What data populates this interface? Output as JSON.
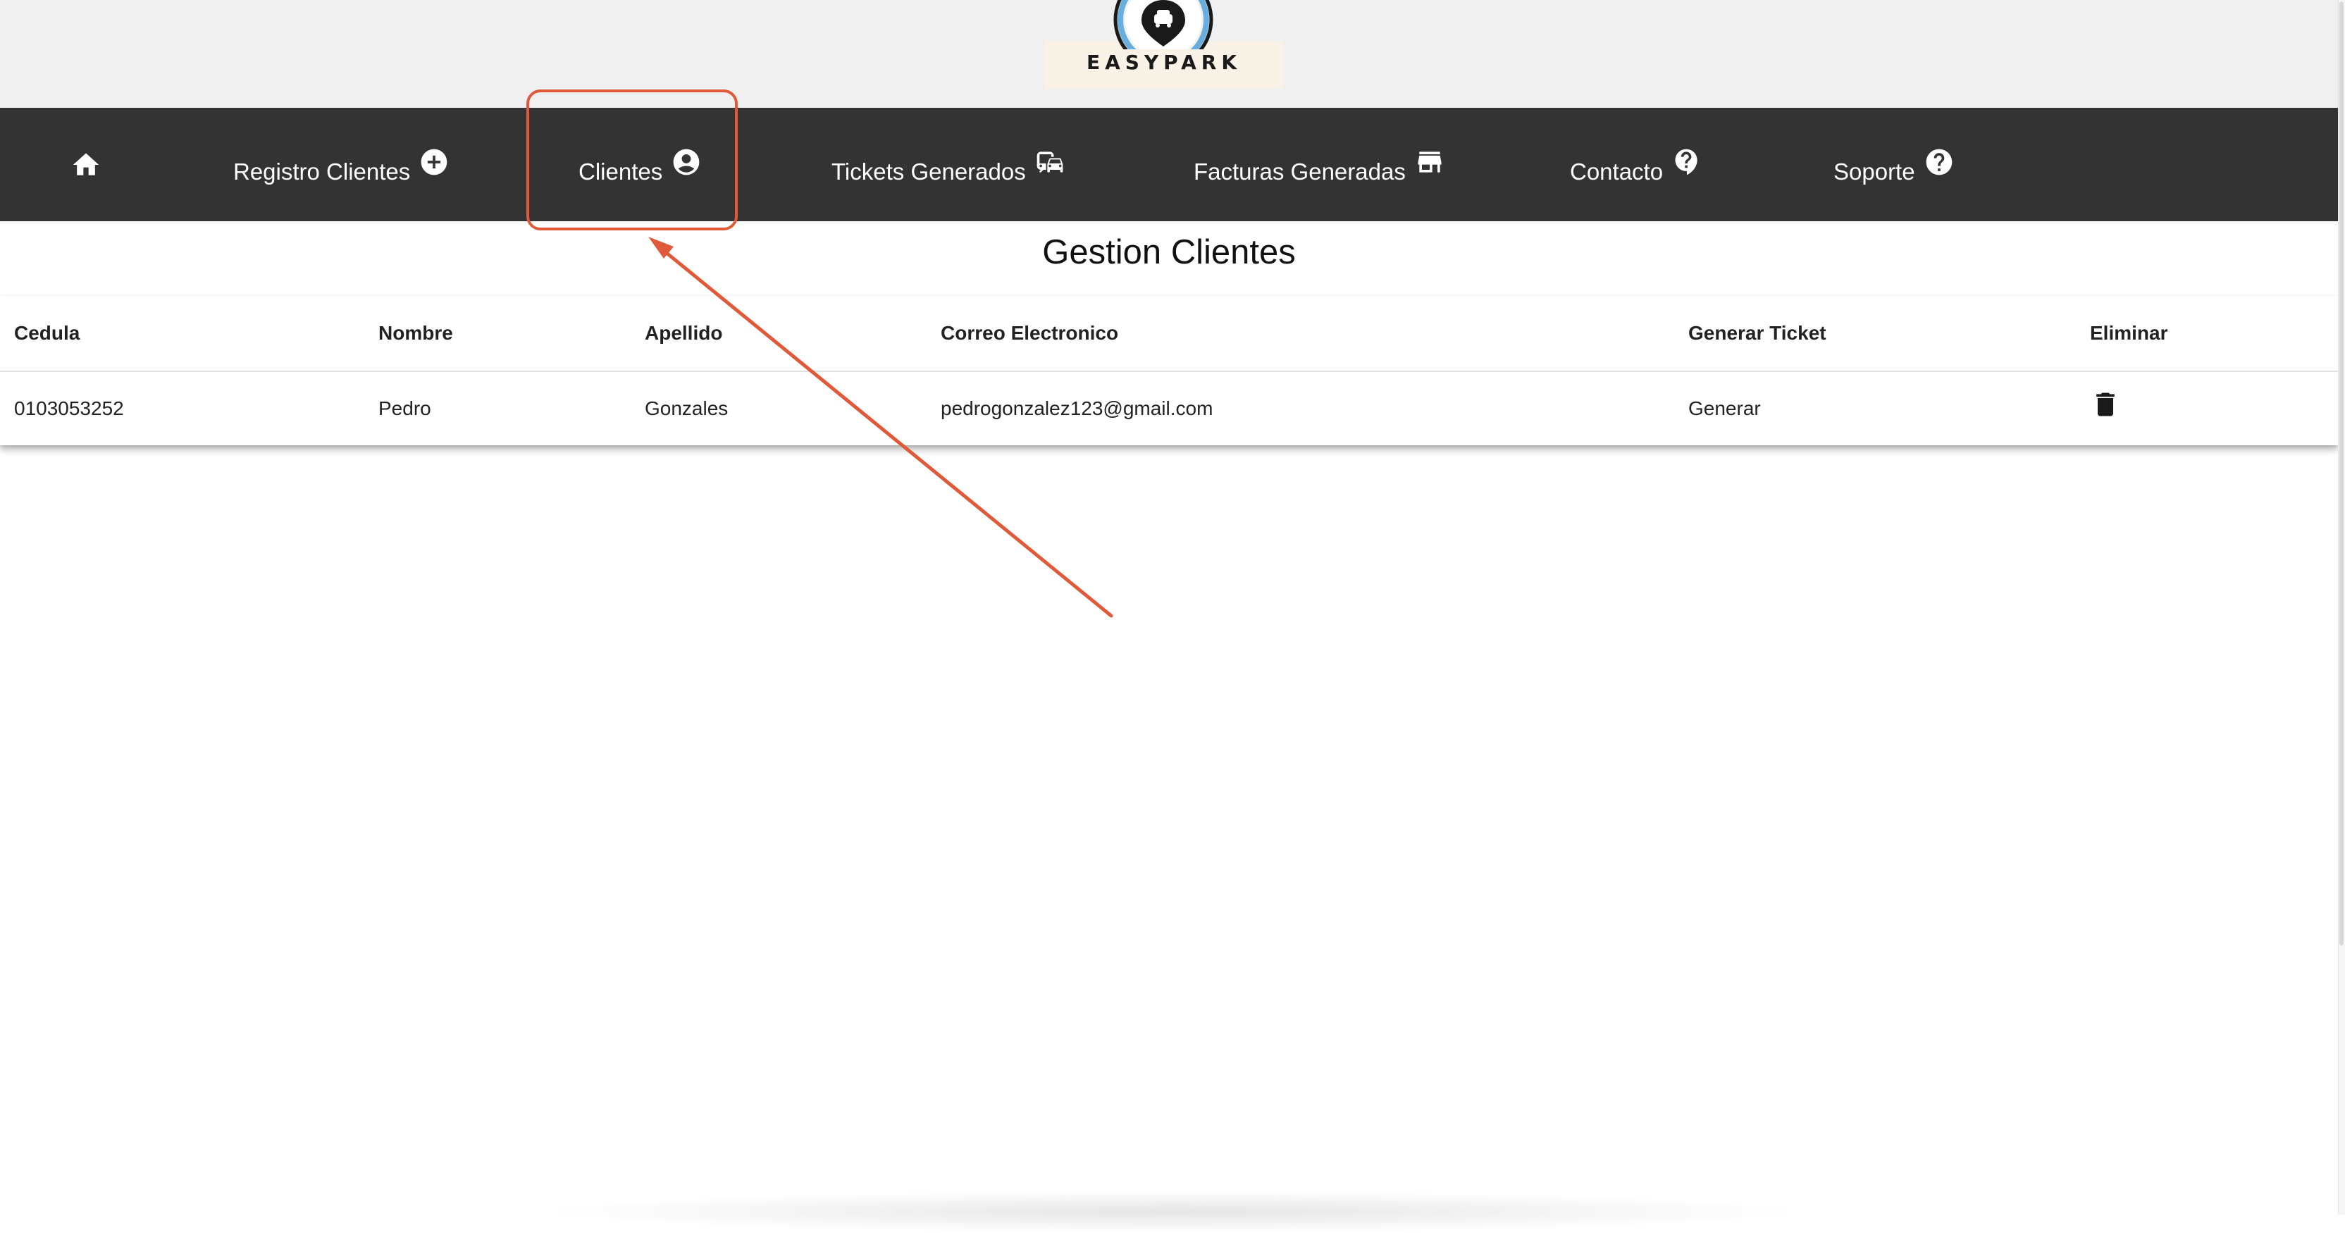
{
  "brand": {
    "name": "EASYPARK",
    "logo_icon": "car-pin-icon"
  },
  "navbar": {
    "items": [
      {
        "label": "",
        "icon": "home-icon"
      },
      {
        "label": "Registro Clientes",
        "icon": "add-circle-icon"
      },
      {
        "label": "Clientes",
        "icon": "account-circle-icon"
      },
      {
        "label": "Tickets Generados",
        "icon": "commute-icon"
      },
      {
        "label": "Facturas Generadas",
        "icon": "store-icon"
      },
      {
        "label": "Contacto",
        "icon": "help-bubble-icon"
      },
      {
        "label": "Soporte",
        "icon": "help-circle-icon"
      }
    ]
  },
  "page": {
    "title": "Gestion Clientes"
  },
  "table": {
    "columns": [
      "Cedula",
      "Nombre",
      "Apellido",
      "Correo Electronico",
      "Generar Ticket",
      "Eliminar"
    ],
    "rows": [
      {
        "cedula": "0103053252",
        "nombre": "Pedro",
        "apellido": "Gonzales",
        "correo": "pedrogonzalez123@gmail.com",
        "generar": "Generar",
        "eliminar_icon": "trash-icon"
      }
    ]
  },
  "annotation": {
    "color": "#e05a3a",
    "target": "Clientes"
  },
  "colors": {
    "navbar_bg": "#333333",
    "header_bg": "#f0f0f0",
    "logo_card_bg": "#f8f3e6",
    "logo_ring": "#6aaee0"
  }
}
